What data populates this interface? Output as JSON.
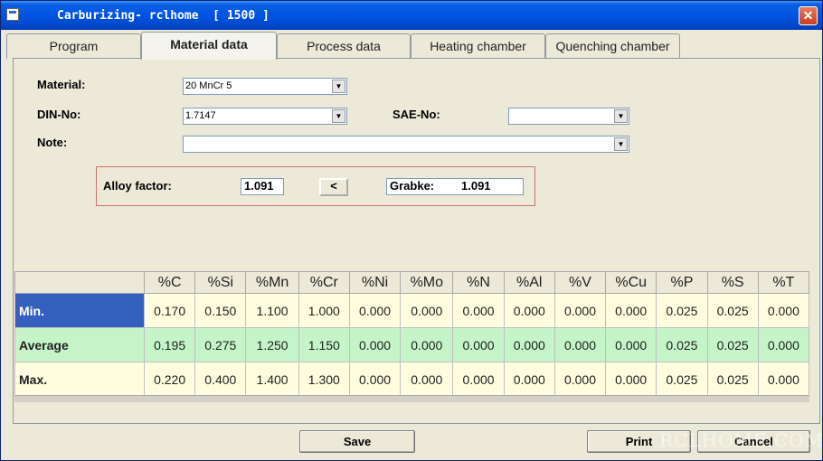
{
  "window": {
    "title": "Carburizing- rclhome  [ 1500 ]",
    "close_glyph": "✕"
  },
  "tabs": [
    {
      "label": "Program"
    },
    {
      "label": "Material data"
    },
    {
      "label": "Process data"
    },
    {
      "label": "Heating chamber"
    },
    {
      "label": "Quenching chamber"
    }
  ],
  "form": {
    "material_label": "Material:",
    "material_value": "20 MnCr 5",
    "din_label": "DIN-No:",
    "din_value": "1.7147",
    "sae_label": "SAE-No:",
    "sae_value": "",
    "note_label": "Note:",
    "note_value": ""
  },
  "alloy": {
    "label": "Alloy factor:",
    "value": "1.091",
    "arrow_button": "<",
    "grabke_label": "Grabke:",
    "grabke_value": "1.091"
  },
  "table": {
    "headers": [
      "%C",
      "%Si",
      "%Mn",
      "%Cr",
      "%Ni",
      "%Mo",
      "%N",
      "%Al",
      "%V",
      "%Cu",
      "%P",
      "%S",
      "%T"
    ],
    "rows": [
      {
        "label": "Min.",
        "values": [
          "0.170",
          "0.150",
          "1.100",
          "1.000",
          "0.000",
          "0.000",
          "0.000",
          "0.000",
          "0.000",
          "0.000",
          "0.025",
          "0.025",
          "0.000"
        ]
      },
      {
        "label": "Average",
        "values": [
          "0.195",
          "0.275",
          "1.250",
          "1.150",
          "0.000",
          "0.000",
          "0.000",
          "0.000",
          "0.000",
          "0.000",
          "0.025",
          "0.025",
          "0.000"
        ]
      },
      {
        "label": "Max.",
        "values": [
          "0.220",
          "0.400",
          "1.400",
          "1.300",
          "0.000",
          "0.000",
          "0.000",
          "0.000",
          "0.000",
          "0.000",
          "0.025",
          "0.025",
          "0.000"
        ]
      }
    ]
  },
  "buttons": {
    "save": "Save",
    "print": "Print",
    "cancel": "Cancel"
  },
  "watermark": "RCLHOME.COM",
  "colors": {
    "titlebar": "#0054e3",
    "min_row_label": "#3560c0",
    "average_row": "#c4f4c8",
    "row_bg": "#fffde0",
    "alloy_border": "#d07070"
  }
}
